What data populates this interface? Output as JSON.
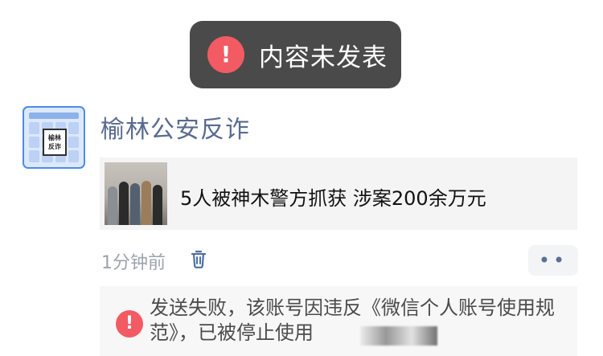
{
  "toast": {
    "message": "内容未发表",
    "icon": "exclamation-icon",
    "icon_color": "#f25b63"
  },
  "post": {
    "account_name": "榆林公安反诈",
    "avatar_badge": "榆林\n反诈",
    "article_title": "5人被神木警方抓获 涉案200余万元",
    "time": "1分钟前"
  },
  "actions": {
    "delete_icon": "trash-icon",
    "more_label": "••"
  },
  "error": {
    "message": "发送失败，该账号因违反《微信个人账号使用规范》，已被停止使用"
  },
  "colors": {
    "account_name": "#586b8f",
    "secondary_text": "#9ca3af",
    "panel_background": "#f4f4f5"
  }
}
